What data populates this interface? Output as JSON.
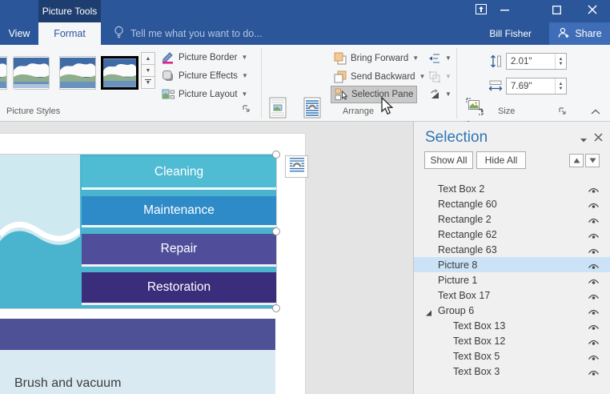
{
  "titlebar": {
    "contextual_tab": "Picture Tools",
    "user": "Bill Fisher",
    "share_label": "Share",
    "tell_me": "Tell me what you want to do...",
    "colors": {
      "titlebar_blue": "#2B579A",
      "contextual_dark": "#1E3E6F",
      "share_bg": "#3F6DB7"
    }
  },
  "tabs": {
    "view": "View",
    "format": "Format"
  },
  "ribbon": {
    "groups": {
      "picture_styles": "Picture Styles",
      "arrange": "Arrange",
      "size": "Size"
    },
    "picture_border": "Picture Border",
    "picture_effects": "Picture Effects",
    "picture_layout": "Picture Layout",
    "position": "Position",
    "wrap_line1": "Wrap",
    "wrap_line2": "Text",
    "bring_forward": "Bring Forward",
    "send_backward": "Send Backward",
    "selection_pane": "Selection Pane",
    "crop": "Crop",
    "size_fields": {
      "height": "2.01\"",
      "width": "7.69\""
    }
  },
  "document": {
    "bars": [
      {
        "label": "Cleaning",
        "color": "#4FBCD4"
      },
      {
        "label": "Maintenance",
        "color": "#2E8BC8"
      },
      {
        "label": "Repair",
        "color": "#504E9B"
      },
      {
        "label": "Restoration",
        "color": "#392D7C"
      }
    ],
    "body_text": "Brush and vacuum",
    "colors": {
      "wave_light": "#CFE9F0",
      "wave_teal": "#4AB4CE",
      "band": "#4E5195",
      "block": "#DAEAF2"
    }
  },
  "selection_pane": {
    "title": "Selection",
    "show_all": "Show All",
    "hide_all": "Hide All",
    "highlight_color": "#CCE3F7",
    "items": [
      {
        "label": "Text Box 2"
      },
      {
        "label": "Rectangle 60"
      },
      {
        "label": "Rectangle 2"
      },
      {
        "label": "Rectangle 62"
      },
      {
        "label": "Rectangle 63"
      },
      {
        "label": "Picture 8",
        "selected": true
      },
      {
        "label": "Picture 1"
      },
      {
        "label": "Text Box 17"
      },
      {
        "label": "Group 6",
        "group": true
      },
      {
        "label": "Text Box 13",
        "child": true
      },
      {
        "label": "Text Box 12",
        "child": true
      },
      {
        "label": "Text Box 5",
        "child": true
      },
      {
        "label": "Text Box 3",
        "child": true
      }
    ]
  }
}
